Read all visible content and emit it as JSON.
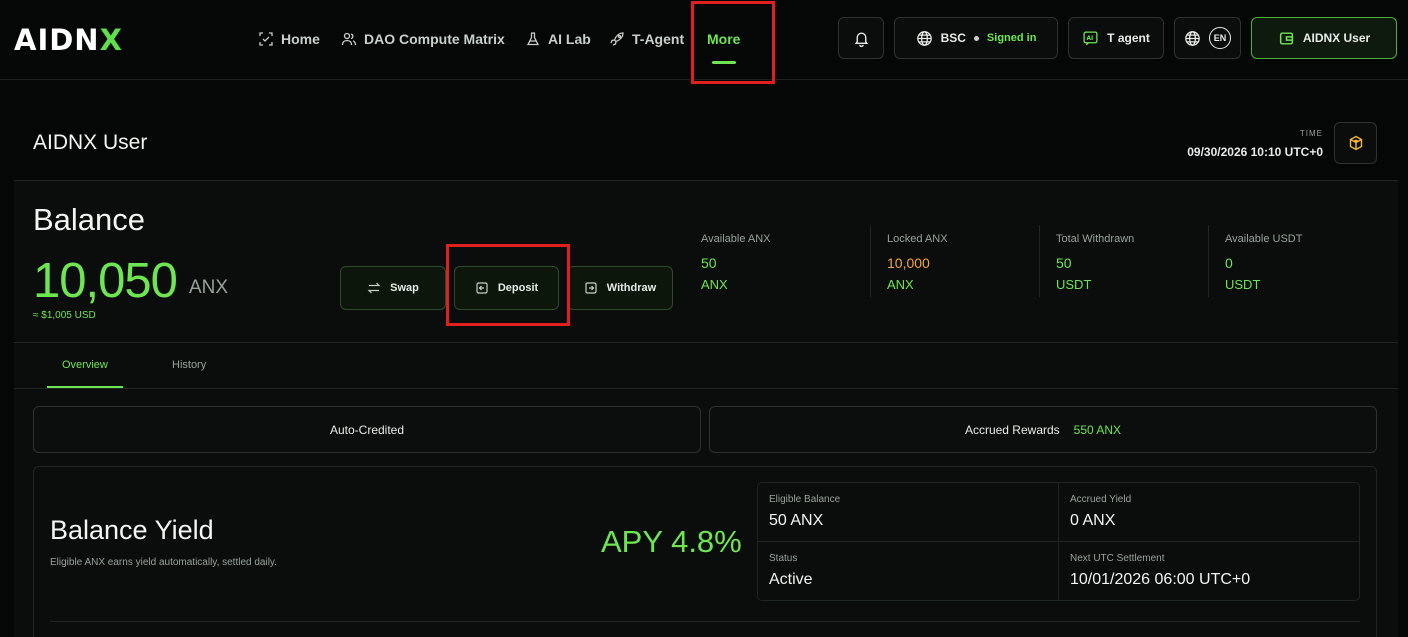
{
  "brand": {
    "logo_prefix": "AIDN",
    "logo_suffix": "X",
    "accent": "#6ee651"
  },
  "nav": {
    "home": "Home",
    "dao": "DAO Compute Matrix",
    "ailab": "AI Lab",
    "tagent": "T-Agent",
    "more": "More"
  },
  "header": {
    "network": "BSC",
    "signed_in": "Signed in",
    "t_agent": "T agent",
    "lang": "EN",
    "user": "AIDNX User"
  },
  "page": {
    "title": "AIDNX User",
    "time_label": "TIME",
    "time_value": "09/30/2026 10:10 UTC+0"
  },
  "balance": {
    "heading": "Balance",
    "value": "10,050",
    "unit": "ANX",
    "usd": "≈ $1,005 USD",
    "swap": "Swap",
    "deposit": "Deposit",
    "withdraw": "Withdraw"
  },
  "stats": [
    {
      "label": "Available ANX",
      "value": "50",
      "unit": "ANX"
    },
    {
      "label": "Locked ANX",
      "value": "10,000",
      "unit": "ANX"
    },
    {
      "label": "Total Withdrawn",
      "value": "50",
      "unit": "USDT"
    },
    {
      "label": "Available USDT",
      "value": "0",
      "unit": "USDT"
    }
  ],
  "tabs": {
    "overview": "Overview",
    "history": "History"
  },
  "pills": {
    "auto_credited": "Auto-Credited",
    "accrued_rewards": "Accrued Rewards",
    "accrued_rewards_value": "550 ANX"
  },
  "yield": {
    "title": "Balance Yield",
    "subtitle": "Eligible ANX earns yield automatically, settled daily.",
    "apy": "APY 4.8%",
    "eligible_label": "Eligible Balance",
    "eligible_value": "50 ANX",
    "accrued_label": "Accrued Yield",
    "accrued_value": "0 ANX",
    "status_label": "Status",
    "status_value": "Active",
    "settle_label": "Next UTC Settlement",
    "settle_value": "10/01/2026 06:00 UTC+0"
  }
}
